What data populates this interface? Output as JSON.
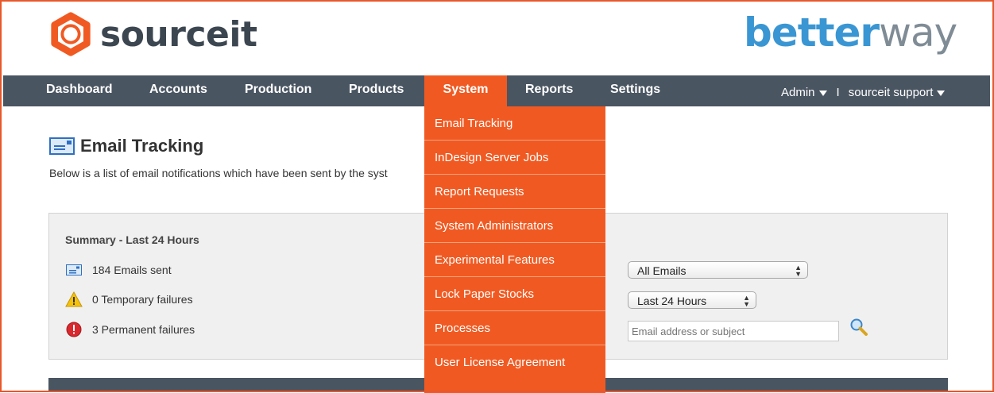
{
  "brand": {
    "logo_text": "sourceit",
    "partner_logo_part1": "better",
    "partner_logo_part2": "way",
    "accent_color": "#f05a22",
    "nav_color": "#4a5562"
  },
  "nav": {
    "items": [
      "Dashboard",
      "Accounts",
      "Production",
      "Products",
      "System",
      "Reports",
      "Settings"
    ],
    "active": "System",
    "admin_label": "Admin",
    "separator": "I",
    "support_label": "sourceit support"
  },
  "system_menu": {
    "items": [
      "Email Tracking",
      "InDesign Server Jobs",
      "Report Requests",
      "System Administrators",
      "Experimental Features",
      "Lock Paper Stocks",
      "Processes",
      "User License Agreement"
    ]
  },
  "page": {
    "title": "Email Tracking",
    "description": "Below is a list of email notifications which have been sent by the syst"
  },
  "summary": {
    "title": "Summary - Last 24 Hours",
    "sent": "184 Emails sent",
    "temporary_failures": "0 Temporary failures",
    "permanent_failures": "3 Permanent failures"
  },
  "filters": {
    "type_selected": "All Emails",
    "period_selected": "Last 24 Hours",
    "search_placeholder": "Email address or subject"
  }
}
